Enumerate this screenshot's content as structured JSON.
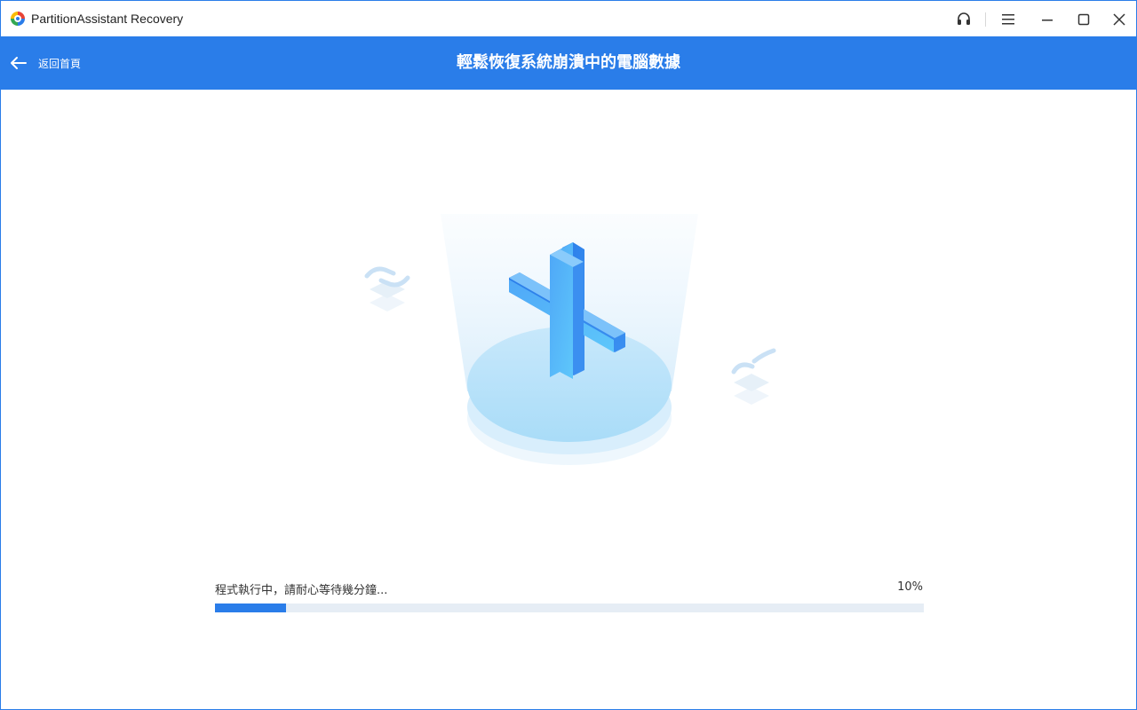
{
  "titlebar": {
    "app_title": "PartitionAssistant Recovery",
    "icons": [
      "headset-icon",
      "menu-icon",
      "minimize-icon",
      "maximize-icon",
      "close-icon"
    ]
  },
  "header": {
    "back_label": "返回首頁",
    "title": "輕鬆恢復系統崩潰中的電腦數據"
  },
  "progress": {
    "status_text": "程式執行中，請耐心等待幾分鐘...",
    "percent_label": "10%",
    "value": 0.1
  },
  "colors": {
    "accent": "#2a7de9",
    "track": "#e6edf5"
  }
}
